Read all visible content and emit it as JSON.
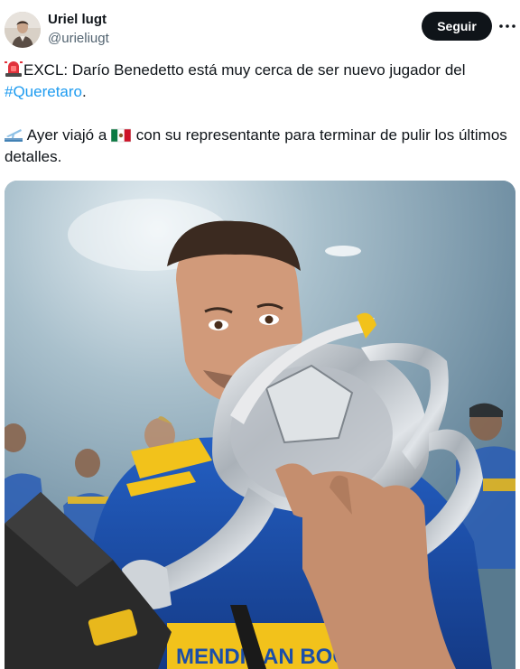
{
  "author": {
    "name": "Uriel lugt",
    "handle": "@urieliugt"
  },
  "actions": {
    "follow_label": "Seguir",
    "more_icon": "more-horizontal-icon"
  },
  "tweet": {
    "line1_prefix_emoji": "rotating-light-emoji",
    "line1_text": "EXCL: Darío Benedetto está muy cerca de ser nuevo jugador del",
    "hashtag": "#Queretaro",
    "hashtag_suffix": ".",
    "line2_prefix_emoji": "airplane-departure-emoji",
    "line2_text_a": " Ayer viajó a ",
    "line2_flag_emoji": "mexico-flag-emoji",
    "line2_text_b": " con su representante para terminar de pulir los últimos detalles."
  },
  "media": {
    "shirt_text": "MENDIGAN BOCA",
    "colors": {
      "jersey_blue": "#1b4ea8",
      "jersey_gold": "#f2c21b",
      "trophy_silver": "#c9ced4",
      "background": "#8fa8b8"
    }
  },
  "colors": {
    "text_primary": "#0f1419",
    "text_secondary": "#536471",
    "link": "#1d9bf0",
    "button_bg": "#0f1419"
  }
}
